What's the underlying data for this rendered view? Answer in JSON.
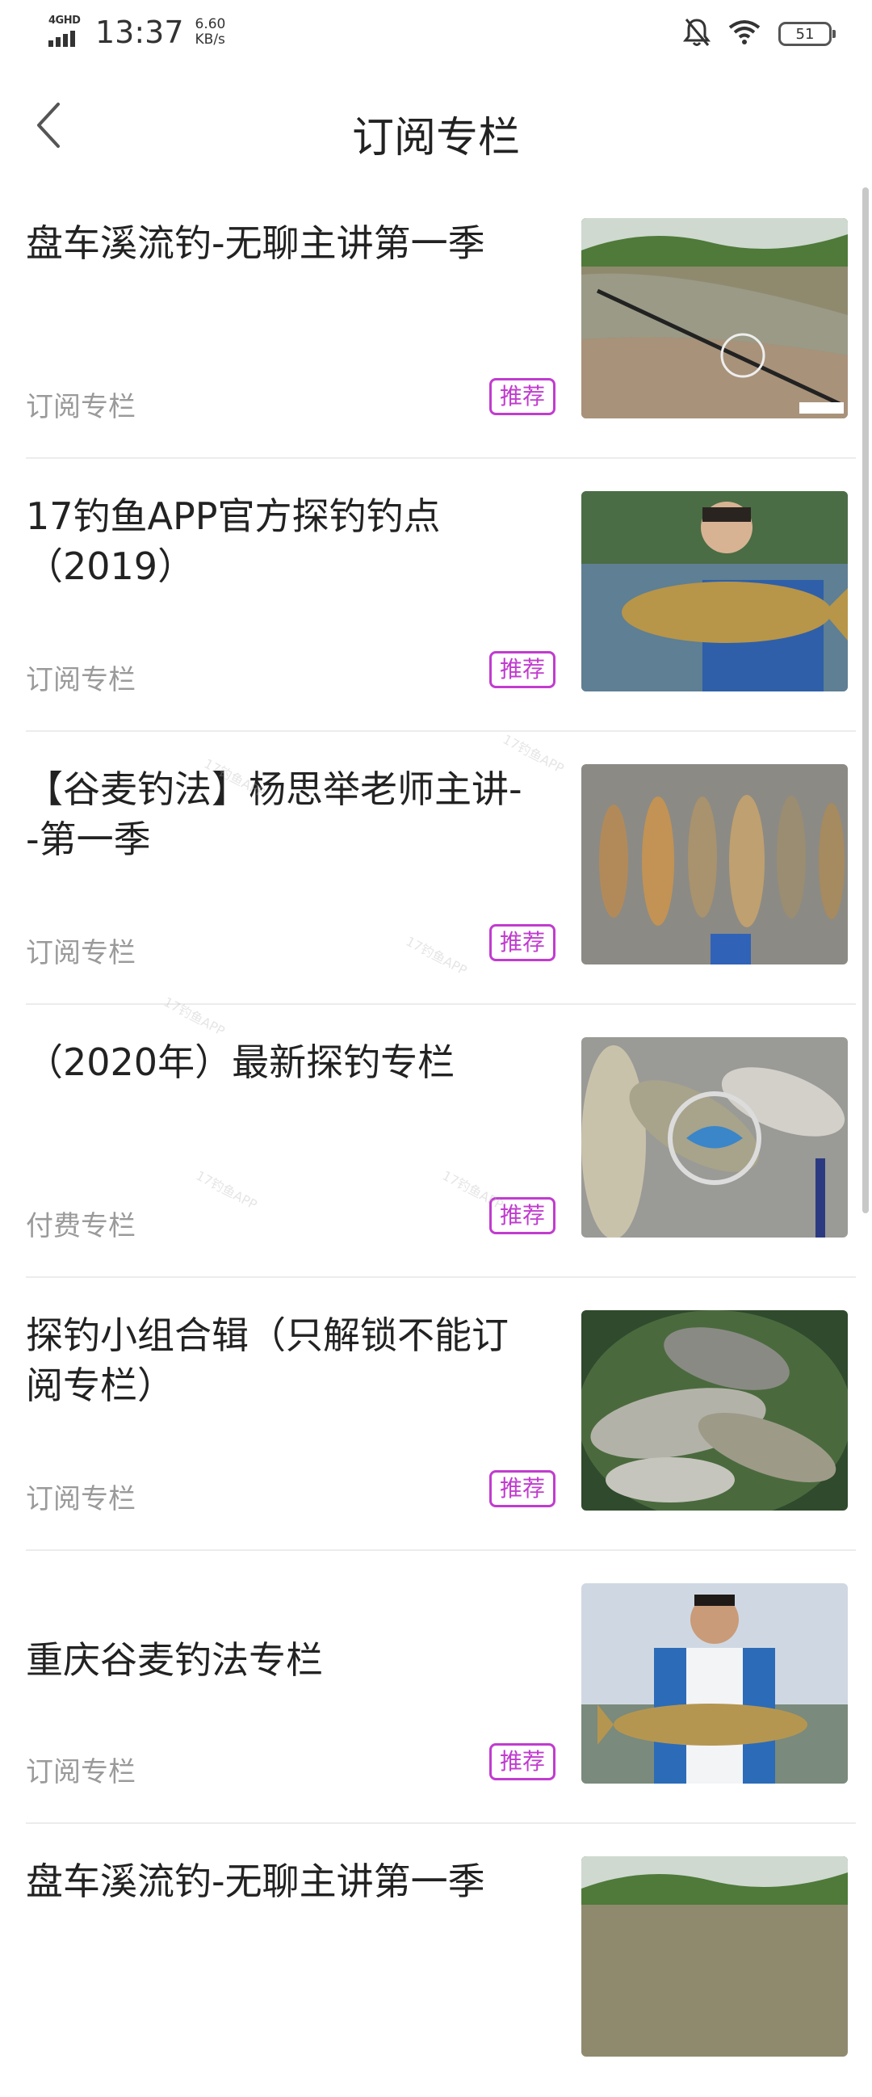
{
  "status_bar": {
    "network": "4GHD",
    "time": "13:37",
    "speed_value": "6.60",
    "speed_unit": "KB/s",
    "battery": "51",
    "icons": [
      "signal-icon",
      "mute-bell-icon",
      "wifi-icon",
      "battery-icon"
    ]
  },
  "nav": {
    "title": "订阅专栏",
    "back_icon": "chevron-left-icon"
  },
  "accent_color": "#c13ccf",
  "items": [
    {
      "title": "盘车溪流钓-无聊主讲第一季",
      "category": "订阅专栏",
      "badge": "推荐"
    },
    {
      "title": "17钓鱼APP官方探钓钓点（2019）",
      "category": "订阅专栏",
      "badge": "推荐"
    },
    {
      "title": "【谷麦钓法】杨思举老师主讲--第一季",
      "category": "订阅专栏",
      "badge": "推荐"
    },
    {
      "title": "（2020年）最新探钓专栏",
      "category": "付费专栏",
      "badge": "推荐"
    },
    {
      "title": "探钓小组合辑（只解锁不能订阅专栏）",
      "category": "订阅专栏",
      "badge": "推荐"
    },
    {
      "title": "重庆谷麦钓法专栏",
      "category": "订阅专栏",
      "badge": "推荐"
    },
    {
      "title": "盘车溪流钓-无聊主讲第一季",
      "category": "",
      "badge": ""
    }
  ],
  "watermark_text": "17钓鱼APP"
}
